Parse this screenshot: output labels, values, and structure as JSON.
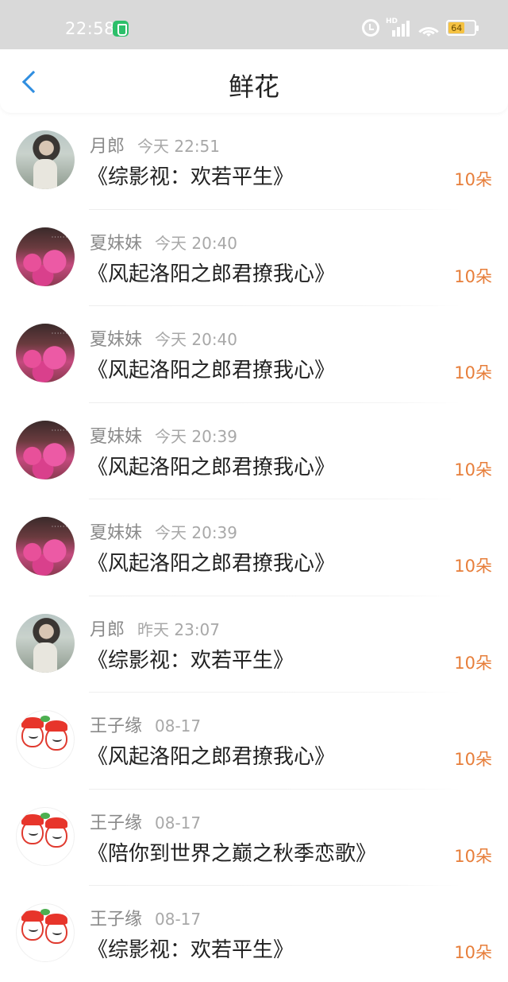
{
  "status_bar": {
    "time": "22:58",
    "network_label": "HD",
    "battery_level": "64"
  },
  "header": {
    "title": "鲜花"
  },
  "records": [
    {
      "avatar": "man",
      "name": "月郎",
      "time": "今天 22:51",
      "book": "《综影视：欢若平生》",
      "amount": "10朵"
    },
    {
      "avatar": "blossom",
      "name": "夏妹妹",
      "time": "今天 20:40",
      "book": "《风起洛阳之郎君撩我心》",
      "amount": "10朵"
    },
    {
      "avatar": "blossom",
      "name": "夏妹妹",
      "time": "今天 20:40",
      "book": "《风起洛阳之郎君撩我心》",
      "amount": "10朵"
    },
    {
      "avatar": "blossom",
      "name": "夏妹妹",
      "time": "今天 20:39",
      "book": "《风起洛阳之郎君撩我心》",
      "amount": "10朵"
    },
    {
      "avatar": "blossom",
      "name": "夏妹妹",
      "time": "今天 20:39",
      "book": "《风起洛阳之郎君撩我心》",
      "amount": "10朵"
    },
    {
      "avatar": "man",
      "name": "月郎",
      "time": "昨天 23:07",
      "book": "《综影视：欢若平生》",
      "amount": "10朵"
    },
    {
      "avatar": "cartoon",
      "name": "王子缘",
      "time": "08-17",
      "book": "《风起洛阳之郎君撩我心》",
      "amount": "10朵"
    },
    {
      "avatar": "cartoon",
      "name": "王子缘",
      "time": "08-17",
      "book": "《陪你到世界之巅之秋季恋歌》",
      "amount": "10朵"
    },
    {
      "avatar": "cartoon",
      "name": "王子缘",
      "time": "08-17",
      "book": "《综影视：欢若平生》",
      "amount": "10朵"
    }
  ],
  "colors": {
    "accent": "#2f8ee0",
    "amount": "#e77e3a",
    "status_bar": "#d9d9d9"
  }
}
